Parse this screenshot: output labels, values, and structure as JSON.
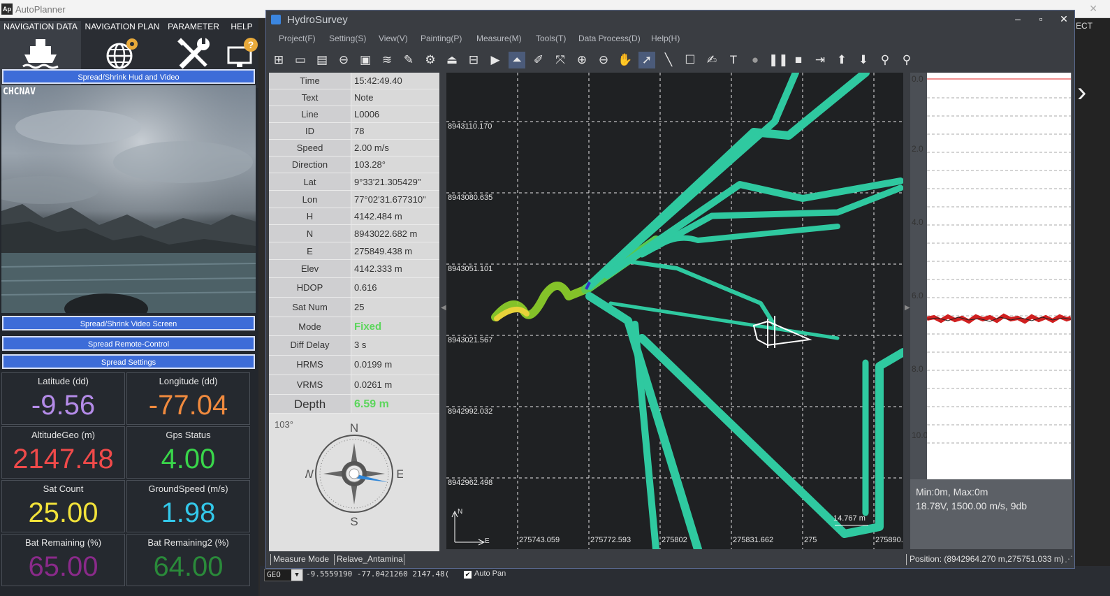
{
  "autoplanner": {
    "title": "AutoPlanner",
    "logo": "Ap",
    "menu": [
      "NAVIGATION DATA",
      "NAVIGATION PLAN",
      "PARAMETER",
      "HELP"
    ],
    "buttons": {
      "spread_hud": "Spread/Shrink Hud and Video",
      "spread_video": "Spread/Shrink Video Screen",
      "spread_remote": "Spread Remote-Control",
      "spread_settings": "Spread Settings"
    },
    "video_label": "CHCNAV",
    "stats": [
      {
        "label": "Latitude (dd)",
        "value": "-9.56",
        "color": "#b48be8"
      },
      {
        "label": "Longitude (dd)",
        "value": "-77.04",
        "color": "#f08a3e"
      },
      {
        "label": "AltitudeGeo (m)",
        "value": "2147.48",
        "color": "#f04a4a"
      },
      {
        "label": "Gps Status",
        "value": "4.00",
        "color": "#39d64a"
      },
      {
        "label": "Sat Count",
        "value": "25.00",
        "color": "#f2e23a"
      },
      {
        "label": "GroundSpeed (m/s)",
        "value": "1.98",
        "color": "#33c8ea"
      },
      {
        "label": "Bat Remaining (%)",
        "value": "65.00",
        "color": "#8a2a8a"
      },
      {
        "label": "Bat Remaining2 (%)",
        "value": "64.00",
        "color": "#2a8a3a"
      }
    ],
    "status": {
      "geo_select": "GEO",
      "coords": "-9.5559190 -77.0421260 2147.48(",
      "autopan": "Auto Pan",
      "autopan_checked": true
    },
    "right_edge_text": "ECT"
  },
  "hydrosurvey": {
    "title": "HydroSurvey",
    "menu": [
      "Project(F)",
      "Setting(S)",
      "View(V)",
      "Painting(P)",
      "Measure(M)",
      "Tools(T)",
      "Data Process(D)",
      "Help(H)"
    ],
    "toolbar_icons": [
      "new-project-icon",
      "open-icon",
      "save-icon",
      "link-icon",
      "image-icon",
      "wave-icon",
      "edit-doc-icon",
      "gear-icon",
      "export-icon",
      "import-icon",
      "video-icon",
      "vessel-icon",
      "pencil-icon",
      "fit-extent-icon",
      "zoom-in-icon",
      "zoom-out-icon",
      "pan-hand-icon",
      "select-arrow-icon",
      "ruler-icon",
      "note-icon",
      "edit-icon",
      "text-icon",
      "record-icon",
      "pause-icon",
      "stop-icon",
      "line-end-icon",
      "up-arrow-icon",
      "down-arrow-icon",
      "marker-icon",
      "marker2-icon"
    ],
    "info": [
      {
        "key": "Time",
        "value": "15:42:49.40"
      },
      {
        "key": "Text",
        "value": "Note"
      },
      {
        "key": "Line",
        "value": "L0006"
      },
      {
        "key": "ID",
        "value": "78"
      },
      {
        "key": "Speed",
        "value": "2.00 m/s"
      },
      {
        "key": "Direction",
        "value": "103.28°"
      },
      {
        "key": "Lat",
        "value": "9°33'21.305429\""
      },
      {
        "key": "Lon",
        "value": "77°02'31.677310\""
      },
      {
        "key": "H",
        "value": "4142.484 m"
      },
      {
        "key": "N",
        "value": "8943022.682 m"
      },
      {
        "key": "E",
        "value": "275849.438 m"
      },
      {
        "key": "Elev",
        "value": "4142.333 m"
      },
      {
        "key": "HDOP",
        "value": "0.616"
      },
      {
        "key": "Sat Num",
        "value": "25"
      },
      {
        "key": "Mode",
        "value": "Fixed"
      },
      {
        "key": "Diff Delay",
        "value": "3 s"
      },
      {
        "key": "HRMS",
        "value": "0.0199 m"
      },
      {
        "key": "VRMS",
        "value": "0.0261 m"
      },
      {
        "key": "Depth",
        "value": "6.59 m"
      }
    ],
    "compass": {
      "heading": "103°",
      "n": "N",
      "s": "S",
      "e": "E",
      "w": "W"
    },
    "map": {
      "y_labels": [
        "8943110.170",
        "8943080.635",
        "8943051.101",
        "8943021.567",
        "8942992.032",
        "8942962.498"
      ],
      "x_labels": [
        "275743.059",
        "275772.593",
        "275802",
        "275831.662",
        "275",
        "275890."
      ],
      "scale": "14.767 m",
      "north": "N",
      "east": "E"
    },
    "depth_panel": {
      "ticks": [
        "0.0",
        "2.0",
        "4.0",
        "6.0",
        "8.0",
        "10.0"
      ],
      "info1": "Min:0m, Max:0m",
      "info2": "18.78V, 1500.00 m/s, 9db"
    },
    "status": {
      "mode": "Measure Mode",
      "project": "Relave_Antamina",
      "position": "Position: (8942964.270 m,275751.033 m)"
    }
  }
}
